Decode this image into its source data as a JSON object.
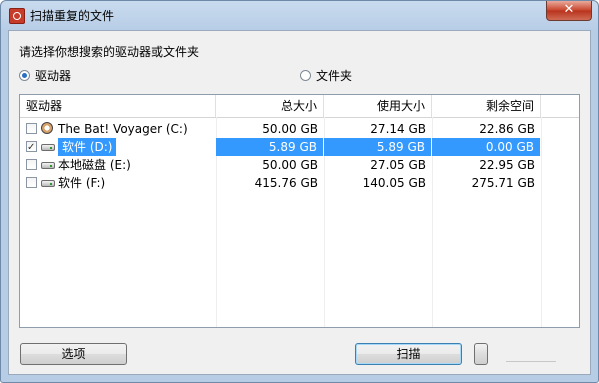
{
  "window": {
    "title": "扫描重复的文件",
    "close_glyph": "✕",
    "app_icon": "app-logo-icon"
  },
  "prompt": "请选择你想搜索的驱动器或文件夹",
  "options": {
    "drives_label": "驱动器",
    "folder_label": "文件夹",
    "selected": "drives"
  },
  "table": {
    "headers": [
      "驱动器",
      "总大小",
      "使用大小",
      "剩余空间"
    ],
    "rows": [
      {
        "name": "The Bat! Voyager (C:)",
        "total": "50.00 GB",
        "used": "27.14 GB",
        "free": "22.86 GB",
        "checked": false,
        "icon": "compass-icon",
        "selected": false
      },
      {
        "name": "软件 (D:)",
        "total": "5.89 GB",
        "used": "5.89 GB",
        "free": "0.00 GB",
        "checked": true,
        "icon": "drive-icon",
        "selected": true
      },
      {
        "name": "本地磁盘 (E:)",
        "total": "50.00 GB",
        "used": "27.05 GB",
        "free": "22.95 GB",
        "checked": false,
        "icon": "drive-icon",
        "selected": false
      },
      {
        "name": "软件 (F:)",
        "total": "415.76 GB",
        "used": "140.05 GB",
        "free": "275.71 GB",
        "checked": false,
        "icon": "drive-icon",
        "selected": false
      }
    ]
  },
  "buttons": {
    "options_label": "选项",
    "scan_label": "扫描"
  },
  "colors": {
    "selection": "#3399ff",
    "titlebar": "#c9dbee",
    "close": "#c7432b"
  }
}
